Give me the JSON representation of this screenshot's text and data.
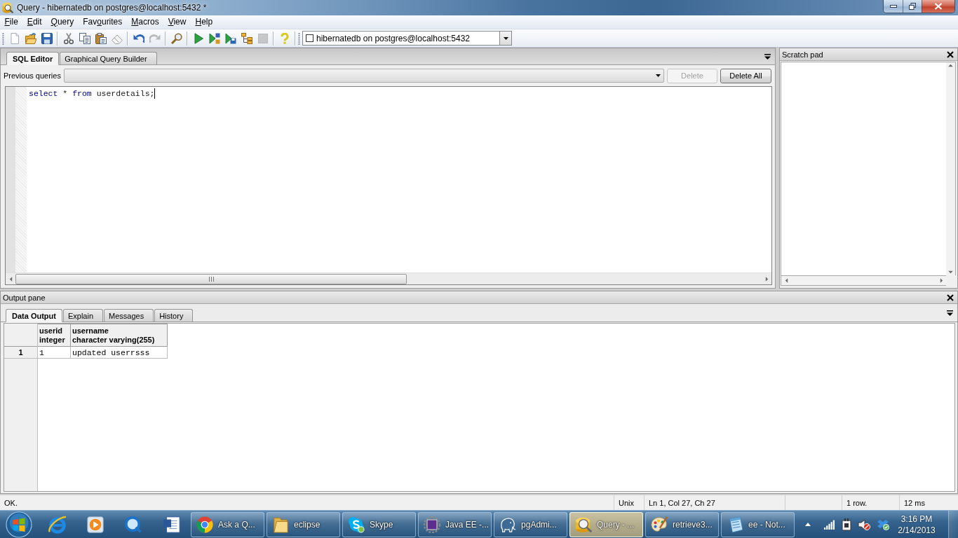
{
  "window": {
    "title": "Query - hibernatedb on postgres@localhost:5432 *"
  },
  "menu": [
    {
      "key": "F",
      "post": "ile"
    },
    {
      "key": "E",
      "post": "dit"
    },
    {
      "key": "Q",
      "post": "uery"
    },
    {
      "pre": "Fav",
      "key": "o",
      "post": "urites"
    },
    {
      "key": "M",
      "post": "acros"
    },
    {
      "key": "V",
      "post": "iew"
    },
    {
      "key": "H",
      "post": "elp"
    }
  ],
  "toolbar": {
    "groups": [
      [
        {
          "kind": "new",
          "disabled": false
        },
        {
          "kind": "open",
          "disabled": false
        },
        {
          "kind": "save",
          "disabled": false
        }
      ],
      [
        {
          "kind": "cut",
          "disabled": false
        },
        {
          "kind": "copy",
          "disabled": false
        },
        {
          "kind": "paste",
          "disabled": false
        },
        {
          "kind": "clear",
          "disabled": false
        }
      ],
      [
        {
          "kind": "undo",
          "disabled": false
        },
        {
          "kind": "redo",
          "disabled": true
        }
      ],
      [
        {
          "kind": "find",
          "disabled": false
        }
      ],
      [
        {
          "kind": "execute",
          "disabled": false
        },
        {
          "kind": "pgscript",
          "disabled": false
        },
        {
          "kind": "file",
          "disabled": false
        },
        {
          "kind": "explain",
          "disabled": false
        },
        {
          "kind": "cancel",
          "disabled": true
        }
      ],
      [
        {
          "kind": "help",
          "disabled": false
        }
      ]
    ],
    "connection": {
      "label": "hibernatedb on postgres@localhost:5432"
    }
  },
  "editor": {
    "tabs": [
      {
        "label": "SQL Editor",
        "selected": true
      },
      {
        "label": "Graphical Query Builder",
        "selected": false
      }
    ],
    "history_label": "Previous queries",
    "buttons": [
      {
        "label": "Delete",
        "disabled": true
      },
      {
        "label": "Delete All",
        "disabled": false
      }
    ],
    "code": [
      {
        "text": "select",
        "kind": "keyword"
      },
      {
        "text": "*",
        "kind": "plain"
      },
      {
        "text": "from",
        "kind": "keyword"
      },
      {
        "text": "userdetails;",
        "kind": "plain"
      }
    ]
  },
  "scratch_pad": {
    "title": "Scratch pad"
  },
  "output_pane": {
    "title": "Output pane",
    "tabs": [
      {
        "label": "Data Output",
        "selected": true
      },
      {
        "label": "Explain",
        "selected": false
      },
      {
        "label": "Messages",
        "selected": false
      },
      {
        "label": "History",
        "selected": false
      }
    ],
    "table": {
      "columns": [
        {
          "name": "userid",
          "type": "integer"
        },
        {
          "name": "username",
          "type": "character varying(255)"
        }
      ],
      "rows": [
        {
          "number": "1",
          "cells": [
            "1",
            "updated userrsss"
          ]
        }
      ]
    }
  },
  "status_bar": {
    "message": "OK.",
    "line_ending": "Unix",
    "position": "Ln 1, Col 27, Ch 27",
    "row_count": "1 row.",
    "duration": "12 ms"
  },
  "taskbar": {
    "tasks": [
      {
        "label": "Ask a Q...",
        "kind": "chrome",
        "selected": false
      },
      {
        "label": "eclipse",
        "kind": "folder",
        "selected": false
      },
      {
        "label": "Skype",
        "kind": "skype",
        "selected": false
      },
      {
        "label": "Java EE -...",
        "kind": "gear",
        "selected": false
      },
      {
        "label": "pgAdmi...",
        "kind": "elephant",
        "selected": false
      },
      {
        "label": "Query - ...",
        "kind": "database",
        "selected": true
      },
      {
        "label": "retrieve3...",
        "kind": "palette",
        "selected": false
      },
      {
        "label": "ee - Not...",
        "kind": "notepad",
        "selected": false
      }
    ],
    "clock": {
      "time": "3:16 PM",
      "date": "2/14/2013"
    }
  }
}
